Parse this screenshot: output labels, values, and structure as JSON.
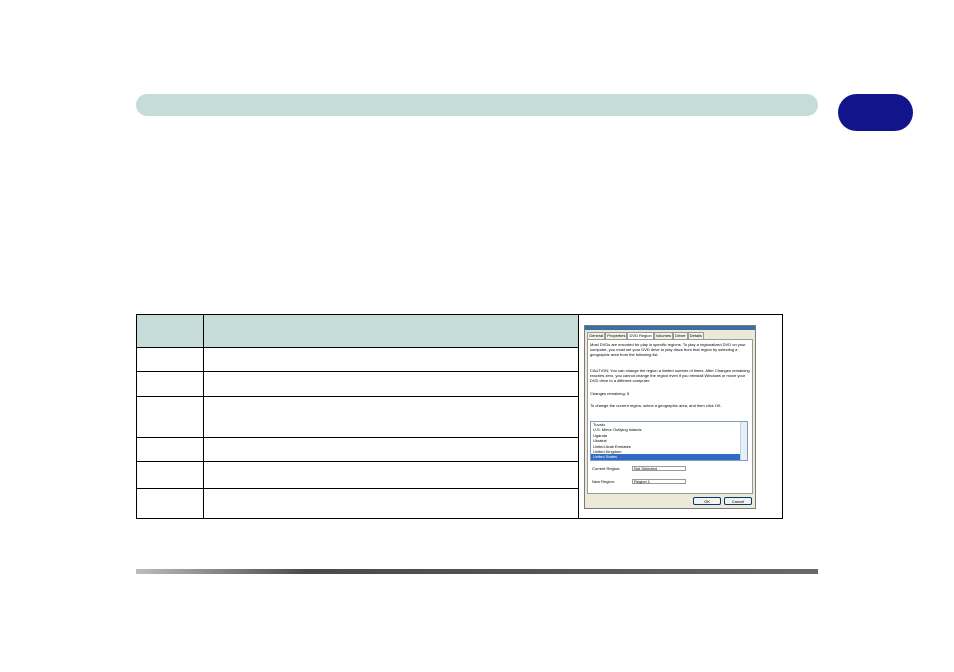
{
  "dialog": {
    "tabs": [
      "General",
      "Properties",
      "DVD Region",
      "Volumes",
      "Driver",
      "Details"
    ],
    "active_tab": "DVD Region",
    "intro": "Most DVDs are encoded for play in specific regions. To play a regionalized DVD on your computer, you must set your DVD drive to play discs from that region by selecting a geographic area from the following list.",
    "caution": "CAUTION: You can change the region a limited number of times. After Changes remaining reaches zero, you cannot change the region even if you reinstall Windows or move your DVD drive to a different computer.",
    "changes_remaining": "Changes remaining: 5",
    "instruction": "To change the current region, select a geographic area, and then click OK.",
    "list_items": [
      "Tuvalu",
      "U.S. Minor Outlying Islands",
      "Uganda",
      "Ukraine",
      "United Arab Emirates",
      "United Kingdom",
      "United States"
    ],
    "selected_item": "United States",
    "current_region_label": "Current Region:",
    "current_region_value": "Not Selected",
    "new_region_label": "New Region:",
    "new_region_value": "Region 1",
    "ok_label": "OK",
    "cancel_label": "Cancel"
  },
  "colors": {
    "header_bar": "#c6dcd8",
    "chapter_tab": "#12148c",
    "list_selection": "#316ac5"
  }
}
